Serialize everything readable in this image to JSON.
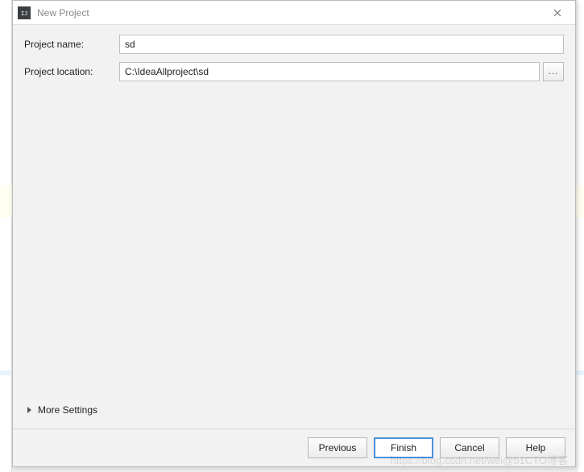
{
  "window": {
    "title": "New Project"
  },
  "form": {
    "name_label": "Project name:",
    "name_value": "sd",
    "location_label": "Project location:",
    "location_value": "C:\\IdeaAllproject\\sd",
    "browse_label": "..."
  },
  "more_settings_label": "More Settings",
  "buttons": {
    "previous": "Previous",
    "finish": "Finish",
    "cancel": "Cancel",
    "help": "Help"
  },
  "watermark": "https://blog.csdn.net/wei@51CTO博客"
}
